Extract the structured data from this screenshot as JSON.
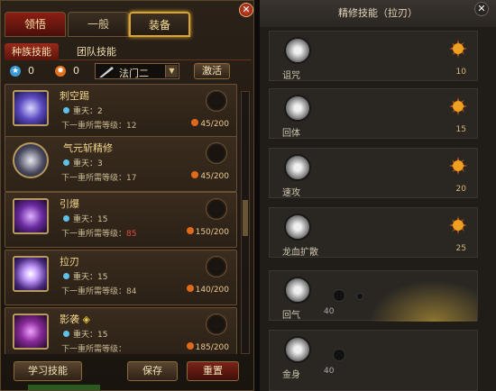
{
  "left": {
    "tabs": [
      "领悟",
      "一般",
      "装备"
    ],
    "subtabs": [
      "种族技能",
      "团队技能"
    ],
    "resources": {
      "blue": "0",
      "orange": "0"
    },
    "class_select": "法门二",
    "activate": "激活",
    "skills": [
      {
        "name": "刺空踢",
        "level": "重天：2",
        "req": "下一重所需等级：",
        "req_val": "12",
        "cost": "45/200"
      },
      {
        "name": "气元斩精修",
        "level": "重天：3",
        "req": "下一重所需等级：",
        "req_val": "17",
        "cost": "45/200"
      },
      {
        "name": "引爆",
        "level": "重天：15",
        "req": "下一重所需等级：",
        "req_val": "85",
        "cost": "150/200"
      },
      {
        "name": "拉刃",
        "level": "重天：15",
        "req": "下一重所需等级：",
        "req_val": "84",
        "cost": "140/200"
      },
      {
        "name": "影袭",
        "level": "重天：15",
        "req": "下一重所需等级：",
        "req_val": "",
        "cost": "185/200"
      }
    ],
    "buttons": {
      "learn": "学习技能",
      "save": "保存",
      "reset": "重置"
    }
  },
  "right": {
    "title": "精修技能（拉刃）",
    "items": [
      {
        "name": "诅咒",
        "value": "10"
      },
      {
        "name": "回体",
        "value": "15"
      },
      {
        "name": "速攻",
        "value": "20"
      },
      {
        "name": "龙血扩散",
        "value": "25"
      },
      {
        "name": "回气",
        "value": ""
      },
      {
        "name": "金身",
        "value": ""
      }
    ],
    "partial_values": [
      "40",
      "40"
    ]
  }
}
